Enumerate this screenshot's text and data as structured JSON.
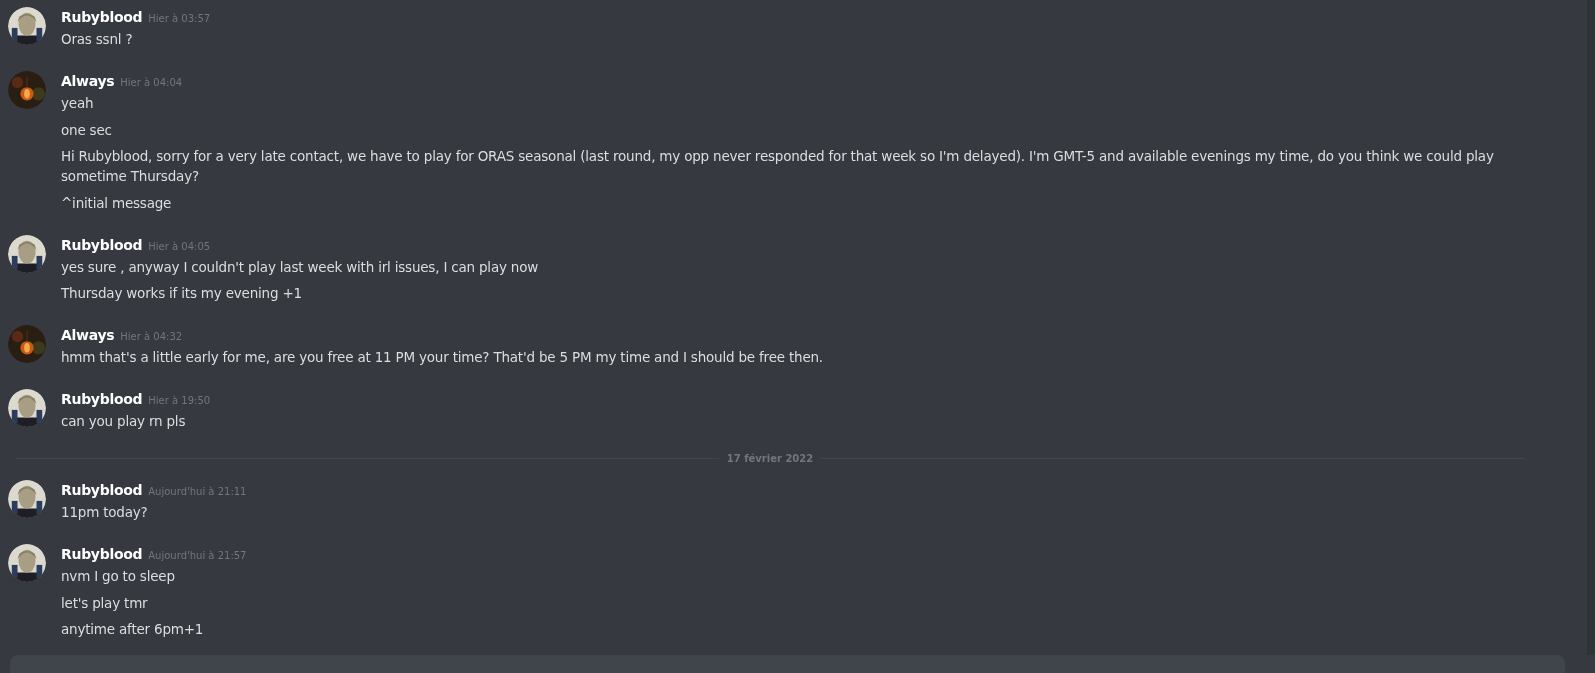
{
  "messages": [
    {
      "kind": "group",
      "author": "Rubyblood",
      "avatar": {
        "kind": "portrait"
      },
      "timestamp": "Hier à 03:57",
      "lines": [
        "Oras ssnl ?"
      ]
    },
    {
      "kind": "group",
      "author": "Always",
      "avatar": {
        "kind": "lamp"
      },
      "timestamp": "Hier à 04:04",
      "lines": [
        "yeah",
        "one sec",
        "Hi Rubyblood, sorry for a very late contact, we have to play for ORAS seasonal (last round, my opp never responded for that week so I'm delayed). I'm GMT-5 and available evenings my time, do you think we could play sometime Thursday?",
        "^initial message"
      ]
    },
    {
      "kind": "group",
      "author": "Rubyblood",
      "avatar": {
        "kind": "portrait"
      },
      "timestamp": "Hier à 04:05",
      "lines": [
        "yes sure , anyway I couldn't play last week with irl issues, I can play now",
        "Thursday works if its my evening +1"
      ]
    },
    {
      "kind": "group",
      "author": "Always",
      "avatar": {
        "kind": "lamp"
      },
      "timestamp": "Hier à 04:32",
      "lines": [
        "hmm that's a little early for me, are you free at 11 PM your time? That'd be 5 PM my time and I should be free then."
      ]
    },
    {
      "kind": "group",
      "author": "Rubyblood",
      "avatar": {
        "kind": "portrait"
      },
      "timestamp": "Hier à 19:50",
      "lines": [
        "can you play rn pls"
      ]
    },
    {
      "kind": "divider",
      "label": "17 février 2022"
    },
    {
      "kind": "group",
      "author": "Rubyblood",
      "avatar": {
        "kind": "portrait"
      },
      "timestamp": "Aujourd'hui à 21:11",
      "lines": [
        "11pm today?"
      ]
    },
    {
      "kind": "group",
      "author": "Rubyblood",
      "avatar": {
        "kind": "portrait"
      },
      "timestamp": "Aujourd'hui à 21:57",
      "lines": [
        "nvm I go to sleep",
        "let's play tmr",
        "anytime after 6pm+1"
      ]
    }
  ]
}
